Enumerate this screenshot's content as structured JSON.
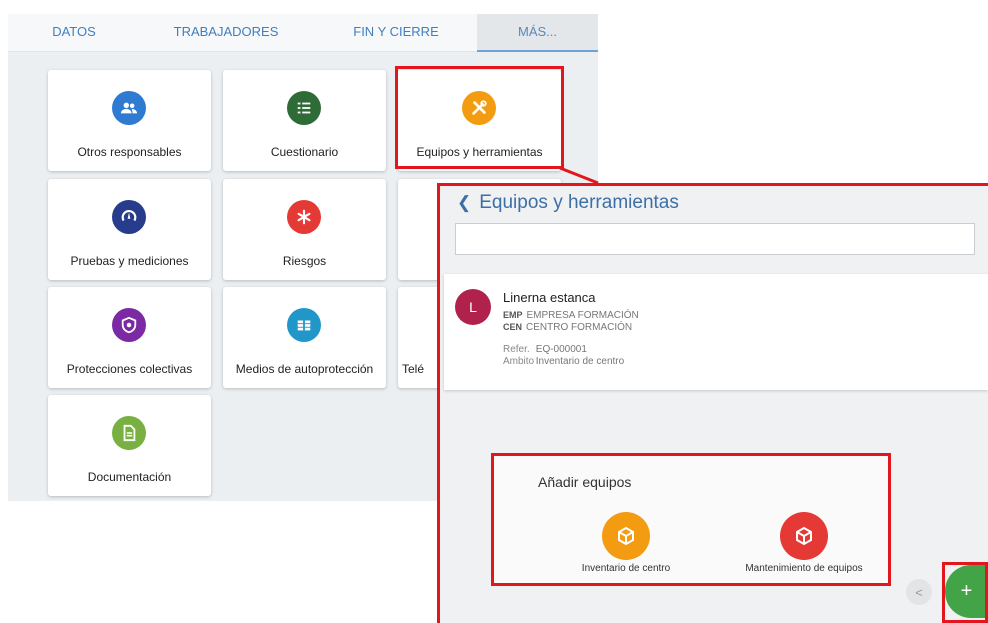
{
  "tabs": [
    {
      "label": "DATOS"
    },
    {
      "label": "TRABAJADORES"
    },
    {
      "label": "FIN Y CIERRE"
    },
    {
      "label": "MÁS..."
    }
  ],
  "tiles": [
    {
      "label": "Otros responsables",
      "icon": "people-icon",
      "color": "#2f7bd2"
    },
    {
      "label": "Cuestionario",
      "icon": "list-icon",
      "color": "#2e6b36"
    },
    {
      "label": "Equipos y herramientas",
      "icon": "tools-icon",
      "color": "#f39c12"
    },
    {
      "label": "Pruebas y mediciones",
      "icon": "gauge-icon",
      "color": "#273c8c"
    },
    {
      "label": "Riesgos",
      "icon": "asterisk-icon",
      "color": "#e53935"
    },
    {
      "label": "Protecciones colectivas",
      "icon": "shield-icon",
      "color": "#7b2aa3"
    },
    {
      "label": "Medios de autoprotección",
      "icon": "extinguisher-icon",
      "color": "#2196c9"
    },
    {
      "label": "Telé",
      "icon": "phone-icon",
      "color": "#ffffff"
    },
    {
      "label": "Documentación",
      "icon": "document-icon",
      "color": "#78b041"
    }
  ],
  "zoom": {
    "title": "Equipos y herramientas",
    "search_placeholder": "",
    "item": {
      "avatar": "L",
      "title": "Linerna estanca",
      "emp_key": "EMP",
      "emp_value": "EMPRESA FORMACIÓN",
      "cen_key": "CEN",
      "cen_value": "CENTRO FORMACIÓN",
      "ref_key": "Refer.",
      "ref_value": "EQ-000001",
      "amb_key": "Ambito",
      "amb_value": "Inventario de centro"
    }
  },
  "add": {
    "title": "Añadir equipos",
    "options": [
      {
        "label": "Inventario de centro",
        "color": "#f39c12"
      },
      {
        "label": "Mantenimiento de equipos",
        "color": "#e53935"
      }
    ]
  },
  "fab_label": "+",
  "back_small": "<",
  "colors": {
    "highlight": "#e4161d",
    "accent": "#3d6fa6",
    "fab": "#43a447"
  }
}
